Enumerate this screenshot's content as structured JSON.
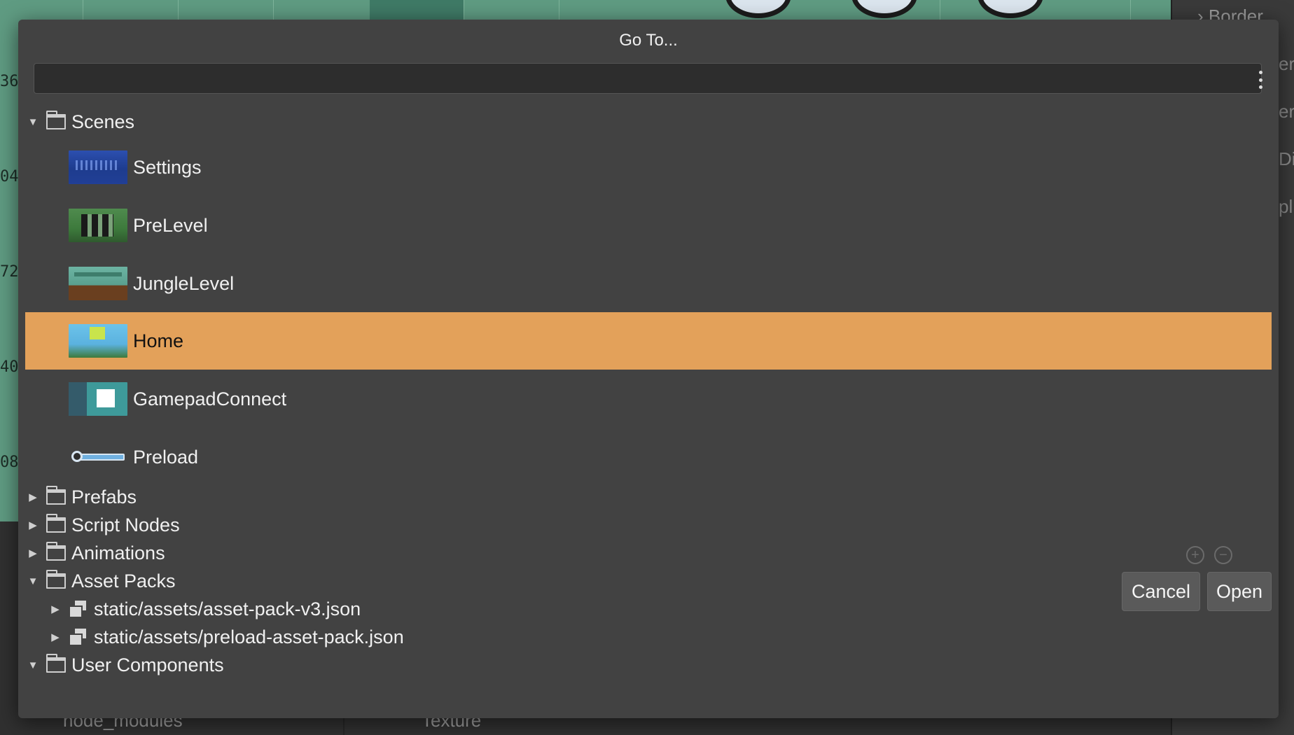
{
  "background": {
    "ruler_ticks": [
      "36",
      "04",
      "72",
      "40",
      "08"
    ],
    "right_panel": {
      "header": "Border",
      "fragments": [
        "er",
        "er",
        "Di",
        "pl"
      ]
    },
    "bottom_labels": {
      "left": "node_modules",
      "right": "Texture"
    }
  },
  "dialog": {
    "title": "Go To...",
    "search": {
      "value": "",
      "placeholder": ""
    },
    "tree": {
      "scenes_folder": "Scenes",
      "scenes": [
        {
          "label": "Settings",
          "selected": false
        },
        {
          "label": "PreLevel",
          "selected": false
        },
        {
          "label": "JungleLevel",
          "selected": false
        },
        {
          "label": "Home",
          "selected": true
        },
        {
          "label": "GamepadConnect",
          "selected": false
        },
        {
          "label": "Preload",
          "selected": false
        }
      ],
      "folders": {
        "prefabs": "Prefabs",
        "script_nodes": "Script Nodes",
        "animations": "Animations",
        "asset_packs": "Asset Packs",
        "user_components": "User Components"
      },
      "asset_packs": [
        "static/assets/asset-pack-v3.json",
        "static/assets/preload-asset-pack.json"
      ]
    },
    "buttons": {
      "cancel": "Cancel",
      "open": "Open"
    },
    "colors": {
      "selection": "#e3a15a",
      "dialog_bg": "#424242"
    }
  }
}
